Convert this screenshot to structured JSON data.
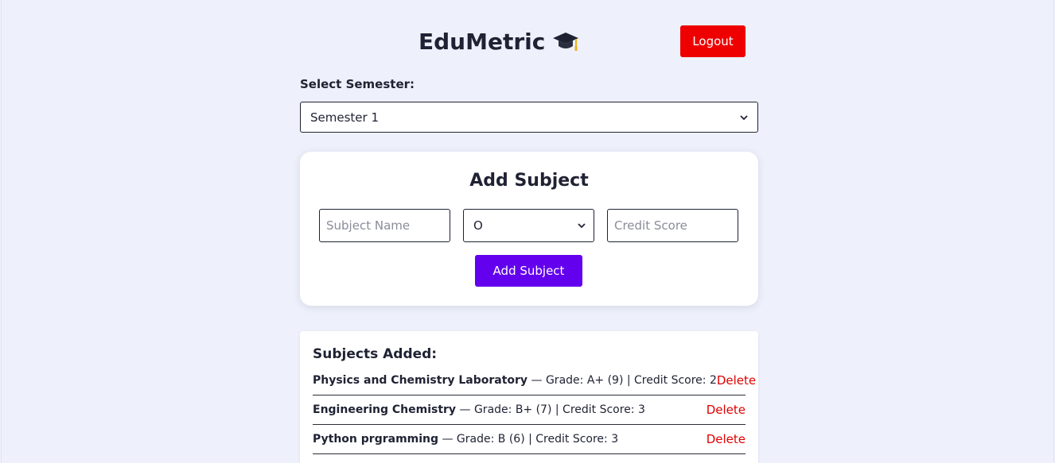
{
  "header": {
    "title": "EduMetric",
    "title_icon": "graduation-cap-icon",
    "logout_label": "Logout"
  },
  "semester": {
    "label": "Select Semester:",
    "selected": "Semester 1"
  },
  "add_subject": {
    "title": "Add Subject",
    "name_placeholder": "Subject Name",
    "grade_selected": "O",
    "credit_placeholder": "Credit Score",
    "button_label": "Add Subject"
  },
  "subjects": {
    "title": "Subjects Added:",
    "items": [
      {
        "name": "Physics and Chemistry Laboratory",
        "details": " — Grade: A+ (9) | Credit Score: 2",
        "delete_label": "Delete"
      },
      {
        "name": "Engineering Chemistry",
        "details": " — Grade: B+ (7) | Credit Score: 3",
        "delete_label": "Delete"
      },
      {
        "name": "Python prgramming",
        "details": " — Grade: B (6) | Credit Score: 3",
        "delete_label": "Delete"
      }
    ]
  },
  "colors": {
    "background": "#eef1fb",
    "logout": "#ee0000",
    "primary": "#6300ee",
    "delete": "#e00000"
  }
}
